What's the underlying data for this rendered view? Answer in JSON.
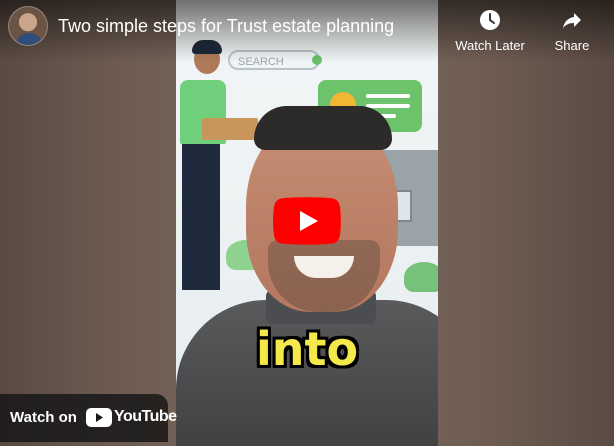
{
  "video": {
    "title": "Two simple steps for Trust estate planning",
    "caption": "into",
    "search_pill_text": "SEARCH"
  },
  "actions": {
    "watch_later": "Watch Later",
    "share": "Share"
  },
  "watch_on": {
    "label": "Watch on",
    "platform": "YouTube"
  },
  "colors": {
    "play_red": "#ff0000",
    "caption_yellow": "#f4e84a"
  },
  "icons": [
    "clock-icon",
    "share-arrow-icon",
    "play-icon",
    "youtube-logo-icon"
  ]
}
